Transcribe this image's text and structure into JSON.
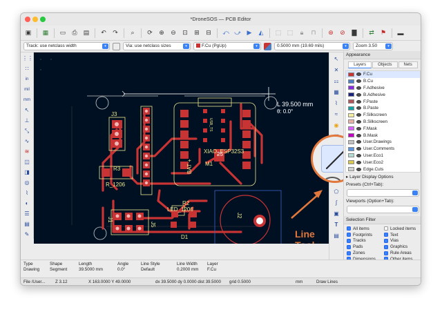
{
  "window": {
    "title": "*DroneSOS — PCB Editor"
  },
  "options": {
    "track": "Track: use netclass width",
    "via": "Via: use netclass sizes",
    "layer": "F.Cu (PgUp)",
    "grid": "0.5000 mm (19.69 mils)",
    "zoom": "Zoom 3.50"
  },
  "canvas": {
    "cursor_readout": "L 39.500 mm",
    "cursor_angle": "θ: 0.0°",
    "labels": {
      "j3": "J3",
      "r3": "R3",
      "r1206": "R_1206",
      "j5": "J5",
      "bat": "BAT +",
      "xiao": "XIAO_ESP32S3",
      "m1": "M1",
      "d1": "D1",
      "led": "LED_1206",
      "r2": "R2",
      "j1": "J1",
      "led_t": "LED",
      "j2": "J2",
      "usb_ts": "USB_TS",
      "t25": "25"
    }
  },
  "appearance": {
    "header": "Appearance",
    "tabs": [
      "Layers",
      "Objects",
      "Nets"
    ],
    "layers": [
      {
        "name": "F.Cu",
        "color": "#c83434"
      },
      {
        "name": "B.Cu",
        "color": "#4d7fc4"
      },
      {
        "name": "F.Adhesive",
        "color": "#8a2be2"
      },
      {
        "name": "B.Adhesive",
        "color": "#1a237e"
      },
      {
        "name": "F.Paste",
        "color": "#b0565b"
      },
      {
        "name": "B.Paste",
        "color": "#16a3a3"
      },
      {
        "name": "F.Silkscreen",
        "color": "#f2eda1"
      },
      {
        "name": "B.Silkscreen",
        "color": "#e8b2a7"
      },
      {
        "name": "F.Mask",
        "color": "#d864ff"
      },
      {
        "name": "B.Mask",
        "color": "#c200c2"
      },
      {
        "name": "User.Drawings",
        "color": "#c2c2c2"
      },
      {
        "name": "User.Comments",
        "color": "#5994dc"
      },
      {
        "name": "User.Eco1",
        "color": "#b4dbd2"
      },
      {
        "name": "User.Eco2",
        "color": "#d8c852"
      },
      {
        "name": "Edge.Cuts",
        "color": "#d0d2cd"
      },
      {
        "name": "Margin",
        "color": "#ff26e2"
      }
    ],
    "layer_display": "Layer Display Options",
    "presets_label": "Presets (Ctrl+Tab):",
    "viewports_label": "Viewports (Option+Tab):"
  },
  "selection_filter": {
    "header": "Selection Filter",
    "items": [
      {
        "label": "All items",
        "checked": true
      },
      {
        "label": "Locked items",
        "checked": false
      },
      {
        "label": "Footprints",
        "checked": true
      },
      {
        "label": "Text",
        "checked": true
      },
      {
        "label": "Tracks",
        "checked": true
      },
      {
        "label": "Vias",
        "checked": true
      },
      {
        "label": "Pads",
        "checked": true
      },
      {
        "label": "Graphics",
        "checked": true
      },
      {
        "label": "Zones",
        "checked": true
      },
      {
        "label": "Rule Areas",
        "checked": true
      },
      {
        "label": "Dimensions",
        "checked": true
      },
      {
        "label": "Other items",
        "checked": true
      }
    ]
  },
  "message_panel": [
    {
      "label": "Type",
      "value": "Drawing"
    },
    {
      "label": "Shape",
      "value": "Segment"
    },
    {
      "label": "Length",
      "value": "39.5000 mm"
    },
    {
      "label": "Angle",
      "value": "0.0°"
    },
    {
      "label": "Line Style",
      "value": "Default"
    },
    {
      "label": "Line Width",
      "value": "0.2000 mm"
    },
    {
      "label": "Layer",
      "value": "F.Cu"
    }
  ],
  "status": {
    "file": "File /User...",
    "z": "Z 3.12",
    "xy": "X 163.0000  Y 49.0000",
    "dxdy": "dx 39.5000  dy 0.0000  dist 39.5000",
    "grid": "grid 0.5000",
    "unit": "mm",
    "mode": "Draw Lines"
  },
  "annotation": {
    "label": "Line Tool",
    "color": "#e2783c"
  }
}
